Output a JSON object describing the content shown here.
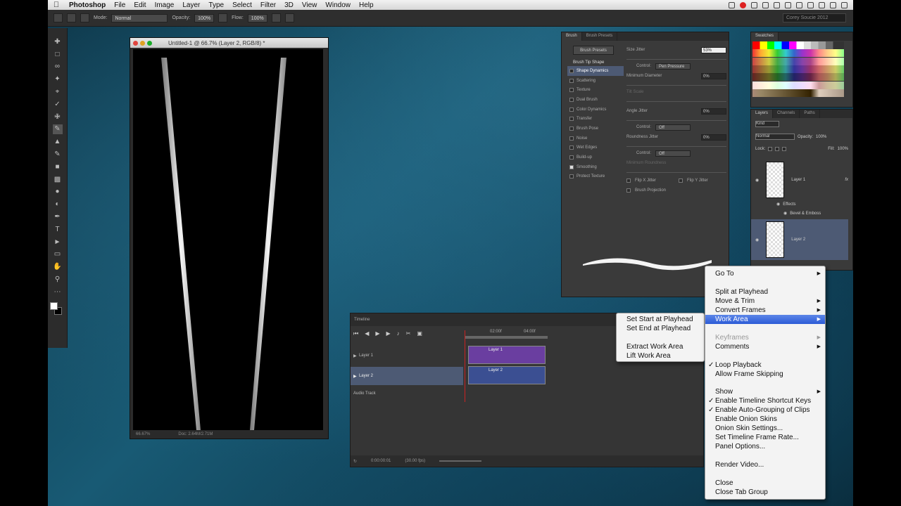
{
  "menubar": {
    "app": "Photoshop",
    "items": [
      "File",
      "Edit",
      "Image",
      "Layer",
      "Type",
      "Select",
      "Filter",
      "3D",
      "View",
      "Window",
      "Help"
    ],
    "search": "Corey Soucie 2012"
  },
  "options": {
    "mode_label": "Mode:",
    "mode": "Normal",
    "opacity_label": "Opacity:",
    "opacity": "100%",
    "flow_label": "Flow:",
    "flow": "100%"
  },
  "document": {
    "title": "Untitled-1 @ 66.7% (Layer 2, RGB/8) *",
    "zoom": "66.67%",
    "doc_size": "Doc: 2.64M/2.71M"
  },
  "brush_panel": {
    "tabs": [
      "Brush",
      "Brush Presets"
    ],
    "presets_button": "Brush Presets",
    "header": "Brush Tip Shape",
    "items": [
      "Shape Dynamics",
      "Scattering",
      "Texture",
      "Dual Brush",
      "Color Dynamics",
      "Transfer",
      "Brush Pose",
      "Noise",
      "Wet Edges",
      "Build-up",
      "Smoothing",
      "Protect Texture"
    ],
    "size_jitter_label": "Size Jitter",
    "size_jitter": "53%",
    "control_label": "Control:",
    "control_value": "Pen Pressure",
    "min_diameter_label": "Minimum Diameter",
    "min_diameter": "0%",
    "tilt_scale_label": "Tilt Scale",
    "angle_jitter_label": "Angle Jitter",
    "angle_jitter": "0%",
    "control2": "Off",
    "roundness_label": "Roundness Jitter",
    "roundness": "0%",
    "control3": "Off",
    "min_roundness_label": "Minimum Roundness",
    "flip_x": "Flip X Jitter",
    "flip_y": "Flip Y Jitter",
    "brush_projection": "Brush Projection"
  },
  "swatches": {
    "title": "Swatches"
  },
  "layers": {
    "tabs": [
      "Layers",
      "Channels",
      "Paths"
    ],
    "kind": "Kind",
    "blend": "Normal",
    "opacity_label": "Opacity:",
    "opacity": "100%",
    "lock_label": "Lock:",
    "fill_label": "Fill:",
    "fill": "100%",
    "layer1": "Layer 1",
    "effects": "Effects",
    "effect1": "Bevel & Emboss",
    "layer2": "Layer 2"
  },
  "timeline": {
    "title": "Timeline",
    "time1": "02:00f",
    "time2": "04:00f",
    "tracks": [
      "Layer 1",
      "Layer 2",
      "Audio Track"
    ],
    "clip1": "Layer 1",
    "clip2": "Layer 2",
    "timecode": "0:00:00:01",
    "fps": "(30.00 fps)"
  },
  "context_menu": {
    "items": [
      {
        "label": "Go To",
        "sub": true
      },
      {
        "label": "Split at Playhead"
      },
      {
        "label": "Move & Trim",
        "sub": true
      },
      {
        "label": "Convert Frames",
        "sub": true
      },
      {
        "label": "Work Area",
        "sub": true,
        "hl": true
      },
      {
        "label": "Keyframes",
        "sub": true,
        "dis": true
      },
      {
        "label": "Comments",
        "sub": true
      },
      {
        "label": "Loop Playback",
        "chk": true
      },
      {
        "label": "Allow Frame Skipping"
      },
      {
        "label": "Show",
        "sub": true
      },
      {
        "label": "Enable Timeline Shortcut Keys",
        "chk": true
      },
      {
        "label": "Enable Auto-Grouping of Clips",
        "chk": true
      },
      {
        "label": "Enable Onion Skins"
      },
      {
        "label": "Onion Skin Settings..."
      },
      {
        "label": "Set Timeline Frame Rate..."
      },
      {
        "label": "Panel Options..."
      },
      {
        "label": "Render Video..."
      },
      {
        "label": "Close"
      },
      {
        "label": "Close Tab Group"
      }
    ]
  },
  "submenu": {
    "items": [
      "Set Start at Playhead",
      "Set End at Playhead",
      "Extract Work Area",
      "Lift Work Area"
    ]
  }
}
